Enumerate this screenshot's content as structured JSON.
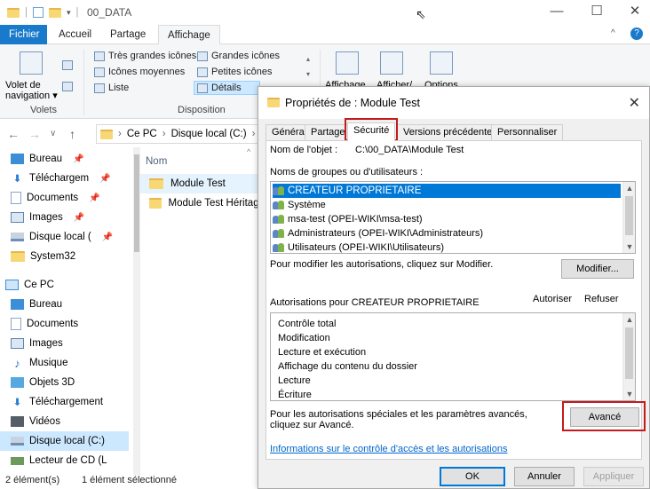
{
  "explorer": {
    "title": "00_DATA",
    "tabs": [
      "Fichier",
      "Accueil",
      "Partage",
      "Affichage"
    ],
    "ribbon": {
      "panes_group": "Volets",
      "nav_pane_label": "Volet de navigation",
      "layout_group": "Disposition",
      "layout_items": [
        "Très grandes icônes",
        "Grandes icônes",
        "Icônes moyennes",
        "Petites icônes",
        "Liste",
        "Détails"
      ],
      "display_label": "Affichage",
      "show_label": "Afficher/",
      "options_label": "Options"
    },
    "address": [
      "Ce PC",
      "Disque local (C:)"
    ],
    "nav": {
      "quick": [
        {
          "label": "Bureau",
          "icon": "desktop-icon",
          "color": "#3c8fd6"
        },
        {
          "label": "Téléchargem",
          "icon": "download-icon",
          "color": "#2a7fd4"
        },
        {
          "label": "Documents",
          "icon": "documents-icon",
          "color": "#8aa7c6"
        },
        {
          "label": "Images",
          "icon": "images-icon",
          "color": "#5e84b3"
        },
        {
          "label": "Disque local (",
          "icon": "drive-icon",
          "color": "#6b8fb8"
        },
        {
          "label": "System32",
          "icon": "folder-icon",
          "color": "#f8d775"
        }
      ],
      "this_pc": "Ce PC",
      "pc_items": [
        {
          "label": "Bureau",
          "icon": "desktop-icon",
          "color": "#3c8fd6"
        },
        {
          "label": "Documents",
          "icon": "documents-icon",
          "color": "#8aa7c6"
        },
        {
          "label": "Images",
          "icon": "images-icon",
          "color": "#5e84b3"
        },
        {
          "label": "Musique",
          "icon": "music-icon",
          "color": "#2a6fc0"
        },
        {
          "label": "Objets 3D",
          "icon": "3d-objects-icon",
          "color": "#55a8e0"
        },
        {
          "label": "Téléchargement",
          "icon": "download-icon",
          "color": "#2a7fd4"
        },
        {
          "label": "Vidéos",
          "icon": "videos-icon",
          "color": "#555d66"
        },
        {
          "label": "Disque local (C:)",
          "icon": "drive-icon",
          "color": "#6b8fb8"
        },
        {
          "label": "Lecteur de CD (L",
          "icon": "cd-drive-icon",
          "color": "#6c9a5a"
        }
      ]
    },
    "files": {
      "column_name": "Nom",
      "rows": [
        "Module Test",
        "Module Test Héritage"
      ]
    },
    "status": {
      "count": "2 élément(s)",
      "selected": "1 élément sélectionné"
    }
  },
  "dialog": {
    "title": "Propriétés de : Module Test",
    "tabs": [
      "Général",
      "Partage",
      "Sécurité",
      "Versions précédentes",
      "Personnaliser"
    ],
    "object_label": "Nom de l'objet :",
    "object_value": "C:\\00_DATA\\Module Test",
    "groups_label": "Noms de groupes ou d'utilisateurs :",
    "groups": [
      "CREATEUR PROPRIETAIRE",
      "Système",
      "msa-test (OPEI-WIKI\\msa-test)",
      "Administrateurs (OPEI-WIKI\\Administrateurs)",
      "Utilisateurs (OPEI-WIKI\\Utilisateurs)"
    ],
    "modify_hint": "Pour modifier les autorisations, cliquez sur Modifier.",
    "modify_button": "Modifier...",
    "permissions_for": "Autorisations pour CREATEUR PROPRIETAIRE",
    "allow_header": "Autoriser",
    "deny_header": "Refuser",
    "permissions": [
      "Contrôle total",
      "Modification",
      "Lecture et exécution",
      "Affichage du contenu du dossier",
      "Lecture",
      "Écriture"
    ],
    "advanced_hint": "Pour les autorisations spéciales et les paramètres avancés, cliquez sur Avancé.",
    "advanced_button": "Avancé",
    "info_link": "Informations sur le contrôle d'accès et les autorisations",
    "ok": "OK",
    "cancel": "Annuler",
    "apply": "Appliquer"
  },
  "colors": {
    "file_tab": "#1979ca",
    "selection": "#0078d7",
    "highlight_box": "#c41a1a"
  }
}
